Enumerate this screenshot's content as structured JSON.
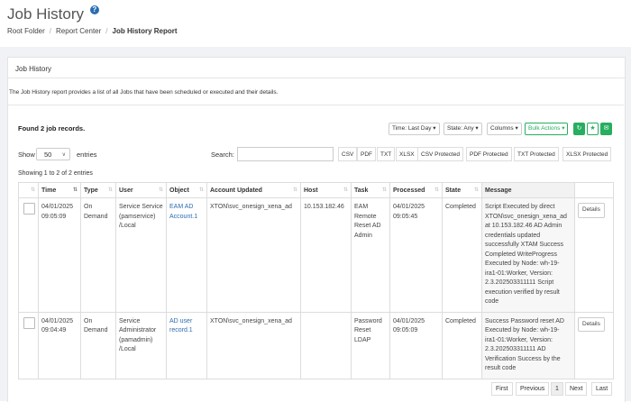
{
  "header": {
    "title": "Job History",
    "help_icon": "?",
    "breadcrumb": [
      "Root Folder",
      "Report Center",
      "Job History Report"
    ]
  },
  "panel": {
    "title": "Job History",
    "description": "The Job History report provides a list of all Jobs that have been scheduled or executed and their details.",
    "found": "Found 2 job records."
  },
  "toolbar": {
    "time": "Time: Last Day ▾",
    "state": "State: Any ▾",
    "columns": "Columns ▾",
    "bulk": "Bulk Actions ▾",
    "accent_color": "#27ae60"
  },
  "controls": {
    "show_label": "Show",
    "page_size": "50",
    "entries_label": "entries",
    "search_label": "Search:",
    "search_value": "",
    "exports": [
      "CSV",
      "PDF",
      "TXT",
      "XLSX",
      "CSV Protected",
      "PDF Protected",
      "TXT Protected",
      "XLSX Protected"
    ],
    "showing": "Showing 1 to 2 of 2 entries"
  },
  "table": {
    "headers": [
      "",
      "Time",
      "Type",
      "User",
      "Object",
      "Account Updated",
      "Host",
      "Task",
      "Processed",
      "State",
      "Message",
      ""
    ],
    "rows": [
      {
        "time": "04/01/2025 09:05:09",
        "type": "On Demand",
        "user": "Service Service (pamservice) /Local",
        "object": "EAM AD Account.1",
        "account": "XTON\\svc_onesign_xena_ad",
        "host": "10.153.182.46",
        "task": "EAM Remote Reset AD Admin",
        "processed": "04/01/2025 09:05:45",
        "state": "Completed",
        "message": "Script Executed by direct XTON\\svc_onesign_xena_ad at 10.153.182.46 AD Admin credentials updated successfully XTAM Success Completed WriteProgress Executed by Node: wh-19-ira1-01:Worker, Version: 2.3.202503311111 Script execution verified by result code",
        "action": "Details"
      },
      {
        "time": "04/01/2025 09:04:49",
        "type": "On Demand",
        "user": "Service Administrator (pamadmin) /Local",
        "object": "AD user record.1",
        "account": "XTON\\svc_onesign_xena_ad",
        "host": "",
        "task": "Password Reset LDAP",
        "processed": "04/01/2025 09:05:09",
        "state": "Completed",
        "message": "Success Password reset AD Executed by Node: wh-19-ira1-01:Worker, Version: 2.3.202503311111 AD Verification Success by the result code",
        "action": "Details"
      }
    ]
  },
  "pagination": {
    "first": "First",
    "previous": "Previous",
    "current": "1",
    "next": "Next",
    "last": "Last"
  }
}
